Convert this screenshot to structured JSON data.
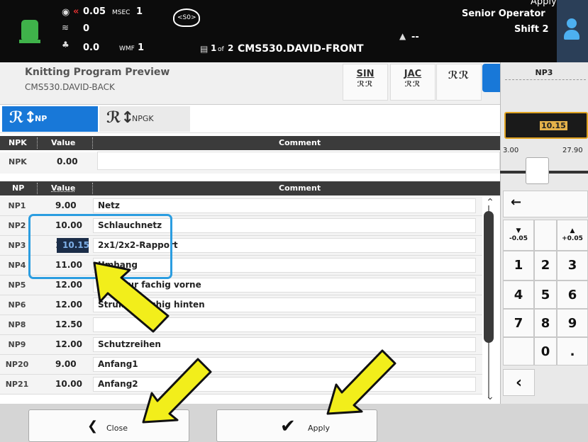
{
  "topbar": {
    "speed": "0.05",
    "speed_unit": "MSEC",
    "speed_count": "1",
    "counter2": "0",
    "wmf_value": "0.0",
    "wmf_label": "WMF",
    "wmf_count": "1",
    "program_icon_label": "<S0>",
    "program_index": "1",
    "program_of": "of",
    "program_total": "2",
    "program_name": "CMS530.DAVID-FRONT",
    "machine_status": "--",
    "operator_role": "Senior Operator",
    "shift": "Shift 2",
    "top_right_partial": "Apply"
  },
  "header": {
    "title": "Knitting Program Preview",
    "subtitle": "CMS530.DAVID-BACK",
    "buttons": [
      {
        "label": "SIN",
        "sub": "ℛℛ"
      },
      {
        "label": "JAC",
        "sub": "ℛℛ"
      },
      {
        "label": "",
        "sub": "ℛℛ"
      }
    ]
  },
  "tabs": [
    {
      "label": "NP",
      "icon": "stitch-icon"
    },
    {
      "label": "NPGK",
      "icon": "stitch-icon"
    }
  ],
  "npk_table": {
    "headers": [
      "NPK",
      "Value",
      "Comment"
    ],
    "row": {
      "np": "NPK",
      "value": "0.00",
      "comment": ""
    }
  },
  "np_table": {
    "headers": [
      "NP",
      "Value",
      "Comment"
    ],
    "rows": [
      {
        "np": "NP1",
        "value": "9.00",
        "comment": "Netz"
      },
      {
        "np": "NP2",
        "value": "10.00",
        "comment": "Schlauchnetz"
      },
      {
        "np": "NP3",
        "value": "10.15",
        "comment": "2x1/2x2-Rapport"
      },
      {
        "np": "NP4",
        "value": "11.00",
        "comment": "Umhang"
      },
      {
        "np": "NP5",
        "value": "12.00",
        "comment": "Struktur fachig vorne"
      },
      {
        "np": "NP6",
        "value": "12.00",
        "comment": "Struktur fachig hinten"
      },
      {
        "np": "NP8",
        "value": "12.50",
        "comment": ""
      },
      {
        "np": "NP9",
        "value": "12.00",
        "comment": "Schutzreihen"
      },
      {
        "np": "NP20",
        "value": "9.00",
        "comment": "Anfang1"
      },
      {
        "np": "NP21",
        "value": "10.00",
        "comment": "Anfang2"
      }
    ]
  },
  "right_panel": {
    "label": "NP3",
    "current_value": "10.15",
    "min": "3.00",
    "max": "27.90",
    "slider_fraction": 0.29,
    "keys": {
      "backspace": "←",
      "minus": "-0.05",
      "plus": "+0.05",
      "k1": "1",
      "k2": "2",
      "k3": "3",
      "k4": "4",
      "k5": "5",
      "k6": "6",
      "k7": "7",
      "k8": "8",
      "k9": "9",
      "k0": "0",
      "dot": ".",
      "back": "‹"
    }
  },
  "footer": {
    "close_label": "Close",
    "apply_label": "Apply"
  },
  "colors": {
    "accent": "#1878d8",
    "highlight": "#2b9de0",
    "status_ok": "#3fb24a",
    "arrow": "#f2ee1b"
  }
}
